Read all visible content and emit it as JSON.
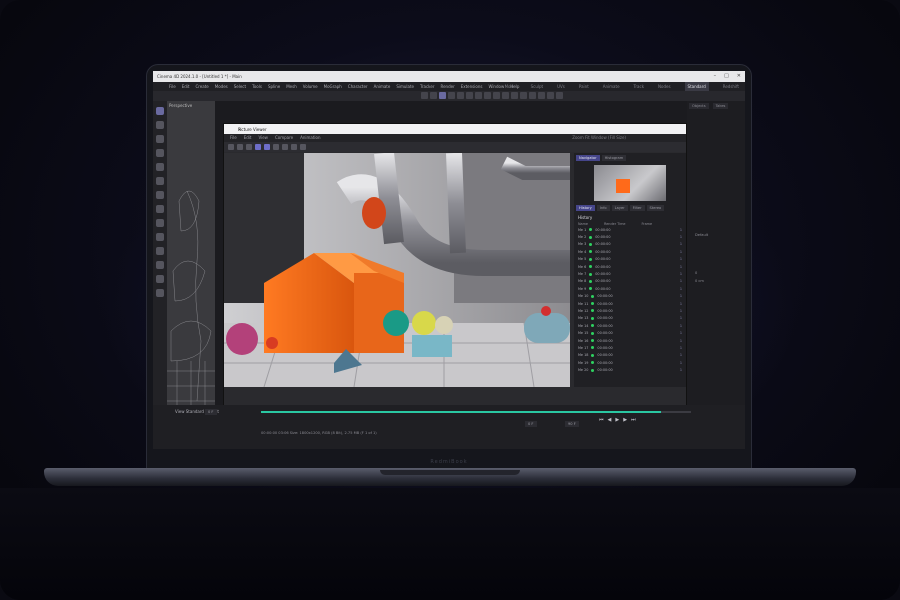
{
  "app": {
    "window_title": "Cinema 4D 2024.1.0 - [Untitled 1 *] - Main",
    "menu": [
      "File",
      "Edit",
      "Create",
      "Modes",
      "Select",
      "Tools",
      "Spline",
      "Mesh",
      "Volume",
      "MoGraph",
      "Character",
      "Animate",
      "Simulate",
      "Tracker",
      "Render",
      "Extensions",
      "Window",
      "Help"
    ],
    "layouts": [
      "Model",
      "Sculpt",
      "UVs",
      "Paint",
      "Animate",
      "Track",
      "Nodes",
      "Standard",
      "Redshift"
    ],
    "active_layout": "Standard"
  },
  "viewport": {
    "label": "Perspective"
  },
  "picture_viewer": {
    "title": "Picture Viewer",
    "menu": [
      "File",
      "Edit",
      "View",
      "Compare",
      "Animation"
    ],
    "zoom_label": "Zoom Fit Window (Fill Size)",
    "side_tabs": [
      "Navigator",
      "Histogram"
    ],
    "info_tabs": [
      "History",
      "Info",
      "Layer",
      "Filter",
      "Stereo"
    ],
    "history_label": "History",
    "columns": [
      "Name",
      "Render Time",
      "Frame"
    ],
    "history_rows": [
      {
        "name": "Me 1",
        "time": "00:00:00",
        "n": "1"
      },
      {
        "name": "Me 2",
        "time": "00:00:00",
        "n": "1"
      },
      {
        "name": "Me 3",
        "time": "00:00:00",
        "n": "1"
      },
      {
        "name": "Me 4",
        "time": "00:00:00",
        "n": "1"
      },
      {
        "name": "Me 5",
        "time": "00:00:00",
        "n": "1"
      },
      {
        "name": "Me 6",
        "time": "00:00:00",
        "n": "1"
      },
      {
        "name": "Me 7",
        "time": "00:00:00",
        "n": "1"
      },
      {
        "name": "Me 8",
        "time": "00:00:00",
        "n": "1"
      },
      {
        "name": "Me 9",
        "time": "00:00:00",
        "n": "1"
      },
      {
        "name": "Me 10",
        "time": "00:00:00",
        "n": "1"
      },
      {
        "name": "Me 11",
        "time": "00:00:00",
        "n": "1"
      },
      {
        "name": "Me 12",
        "time": "00:00:00",
        "n": "1"
      },
      {
        "name": "Me 13",
        "time": "00:00:00",
        "n": "1"
      },
      {
        "name": "Me 14",
        "time": "00:00:00",
        "n": "1"
      },
      {
        "name": "Me 15",
        "time": "00:00:00",
        "n": "1"
      },
      {
        "name": "Me 16",
        "time": "00:00:00",
        "n": "1"
      },
      {
        "name": "Me 17",
        "time": "00:00:00",
        "n": "1"
      },
      {
        "name": "Me 18",
        "time": "00:00:00",
        "n": "1"
      },
      {
        "name": "Me 19",
        "time": "00:00:00",
        "n": "1"
      },
      {
        "name": "Me 20",
        "time": "00:00:00",
        "n": "1"
      }
    ]
  },
  "right_panel": {
    "tabs": [
      "Objects",
      "Takes"
    ],
    "rows": [
      "Default",
      "0",
      "0 cm"
    ]
  },
  "timeline": {
    "label": "View Standard Project",
    "progress": 0.93,
    "info": "00:00:00 03:06   Size: 1800x1200, RGB (8 Bit), 2.75 MB   (F 1 of 1)",
    "start": "0 F",
    "end": "90 F",
    "current": "0 F"
  },
  "brand": "RedmiBook"
}
